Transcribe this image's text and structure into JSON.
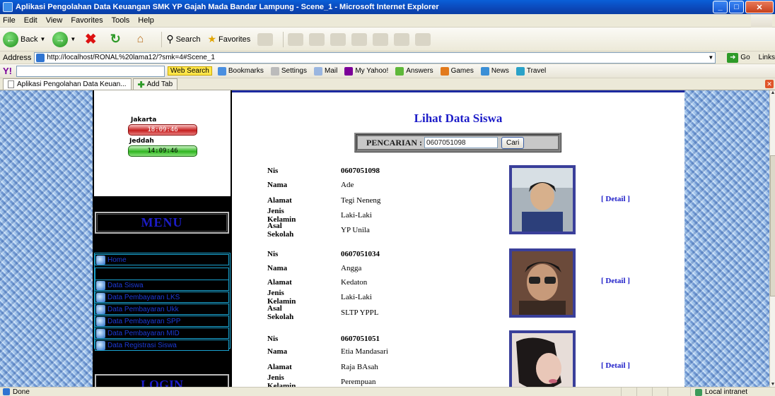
{
  "window": {
    "title": "Aplikasi Pengolahan Data Keuangan SMK YP Gajah Mada Bandar Lampung - Scene_1 - Microsoft Internet Explorer"
  },
  "menubar": [
    "File",
    "Edit",
    "View",
    "Favorites",
    "Tools",
    "Help"
  ],
  "toolbar": {
    "back_label": "Back",
    "search_label": "Search",
    "favorites_label": "Favorites"
  },
  "address": {
    "label": "Address",
    "url": "http://localhost/RONAL%20lama12/?smk=4#Scene_1",
    "go_label": "Go",
    "links_label": "Links"
  },
  "yahoo": {
    "web_search": "Web Search",
    "bookmarks": "Bookmarks",
    "settings": "Settings",
    "mail": "Mail",
    "my_yahoo": "My Yahoo!",
    "answers": "Answers",
    "games": "Games",
    "news": "News",
    "travel": "Travel"
  },
  "tabs": {
    "active_tab": "Aplikasi Pengolahan Data Keuan...",
    "add_tab": "Add Tab"
  },
  "clock": {
    "city1": "Jakarta",
    "time1": "18:09:46",
    "city2": "Jeddah",
    "time2": "14:09:46"
  },
  "sidebar": {
    "menu_title": "MENU",
    "items": [
      {
        "label": "Home"
      },
      {
        "label": "Data Siswa"
      },
      {
        "label": "Data Pembayaran LKS"
      },
      {
        "label": "Data Pembayaran Ukk"
      },
      {
        "label": "Data Pembayaran SPP"
      },
      {
        "label": "Data Pembayaran MID"
      },
      {
        "label": "Data Registrasi Siswa"
      }
    ],
    "login_title": "LOGIN"
  },
  "main": {
    "title": "Lihat Data Siswa",
    "search_label": "PENCARIAN :",
    "search_value": "0607051098",
    "search_button": "Cari",
    "field_labels": {
      "nis": "Nis",
      "nama": "Nama",
      "alamat": "Alamat",
      "jenis_kelamin": "Jenis Kelamin",
      "asal_sekolah": "Asal Sekolah"
    },
    "detail_label": "[ Detail ]",
    "records": [
      {
        "nis": "0607051098",
        "nama": "Ade",
        "alamat": "Tegi Neneng",
        "jenis_kelamin": "Laki-Laki",
        "asal_sekolah": "YP Unila"
      },
      {
        "nis": "0607051034",
        "nama": "Angga",
        "alamat": "Kedaton",
        "jenis_kelamin": "Laki-Laki",
        "asal_sekolah": "SLTP YPPL"
      },
      {
        "nis": "0607051051",
        "nama": "Etia Mandasari",
        "alamat": "Raja BAsah",
        "jenis_kelamin": "Perempuan",
        "asal_sekolah": ""
      }
    ]
  },
  "status": {
    "left": "Done",
    "zone": "Local intranet"
  }
}
